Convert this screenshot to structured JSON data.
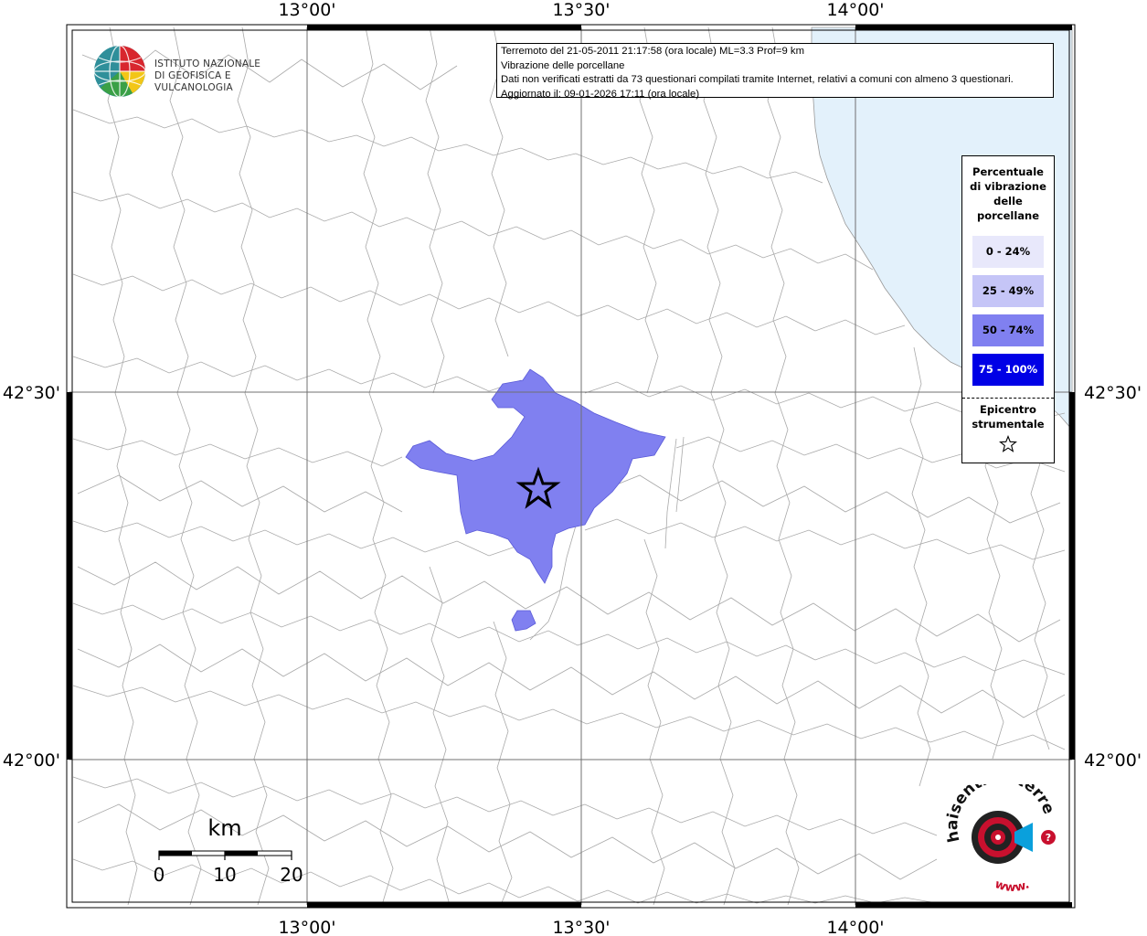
{
  "header": {
    "line1": "Terremoto del 21-05-2011 21:17:58 (ora locale) ML=3.3 Prof=9 km",
    "line2": "Vibrazione delle porcellane",
    "line3": "Dati non verificati estratti da 73 questionari compilati tramite Internet, relativi a comuni con almeno 3 questionari.",
    "line4": "Aggiornato il: 09-01-2026 17:11 (ora locale)"
  },
  "ingv_logo": {
    "line1": "ISTITUTO NAZIONALE",
    "line2": "DI GEOFISICA E VULCANOLOGIA"
  },
  "axes": {
    "top_ticks": [
      "13°00'",
      "13°30'",
      "14°00'"
    ],
    "bottom_ticks": [
      "13°00'",
      "13°30'",
      "14°00'"
    ],
    "left_ticks": [
      "42°30'",
      "42°00'"
    ],
    "right_ticks": [
      "42°30'",
      "42°00'"
    ]
  },
  "legend": {
    "title_lines": [
      "Percentuale",
      "di vibrazione",
      "delle",
      "porcellane"
    ],
    "classes": [
      {
        "label": "0 - 24%",
        "color": "#e8e8fb"
      },
      {
        "label": "25 - 49%",
        "color": "#c5c5f7"
      },
      {
        "label": "50 - 74%",
        "color": "#8080f0"
      },
      {
        "label": "75 - 100%",
        "color": "#0000e6"
      }
    ],
    "epicenter_lines": [
      "Epicentro",
      "strumentale"
    ],
    "epicenter_icon": "star-icon"
  },
  "scale_bar": {
    "unit": "km",
    "labels": [
      "0",
      "10",
      "20"
    ]
  },
  "hsit_logo": {
    "text": "haisentitoilterremoto.it",
    "www": "www."
  },
  "colors": {
    "sea": "#e3f1fb",
    "affected_area": "#8080f0",
    "boundaries": "#a0a0a0",
    "grid": "#707070"
  }
}
